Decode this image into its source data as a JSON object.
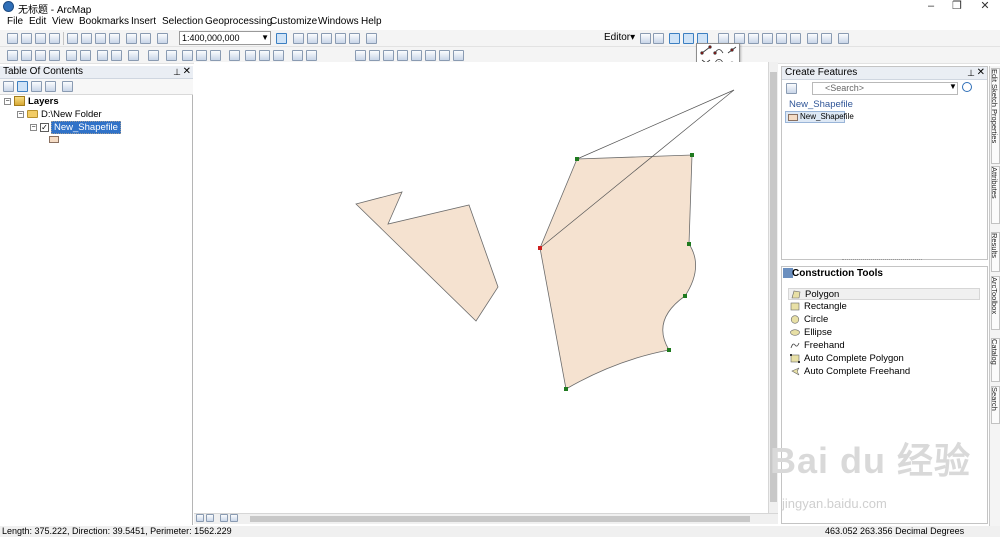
{
  "window": {
    "title": "无标题 - ArcMap",
    "buttons": [
      "–",
      "❐",
      "✕"
    ]
  },
  "menu": [
    "File",
    "Edit",
    "View",
    "Bookmarks",
    "Insert",
    "Selection",
    "Geoprocessing",
    "Customize",
    "Windows",
    "Help"
  ],
  "toolbar": {
    "scale": "1:400,000,000",
    "editor_label": "Editor▾"
  },
  "toc": {
    "title": "Table Of Contents",
    "root": "Layers",
    "folder": "D:\\New Folder",
    "layer": "New_Shapefile",
    "layer_checked": true
  },
  "create_features": {
    "title": "Create Features",
    "search_placeholder": "<Search>",
    "group_label": "New_Shapefile",
    "template_label": "New_Shapefile"
  },
  "construction_tools": {
    "title": "Construction Tools",
    "items": [
      {
        "label": "Polygon",
        "icon": "polygon-icon",
        "active": true
      },
      {
        "label": "Rectangle",
        "icon": "rectangle-icon",
        "active": false
      },
      {
        "label": "Circle",
        "icon": "circle-icon",
        "active": false
      },
      {
        "label": "Ellipse",
        "icon": "ellipse-icon",
        "active": false
      },
      {
        "label": "Freehand",
        "icon": "freehand-icon",
        "active": false
      },
      {
        "label": "Auto Complete Polygon",
        "icon": "auto-complete-polygon-icon",
        "active": false
      },
      {
        "label": "Auto Complete Freehand",
        "icon": "auto-complete-freehand-icon",
        "active": false
      }
    ]
  },
  "side_tabs": [
    "Edit Sketch Properties",
    "Attributes",
    "Results",
    "ArcToolbox",
    "Catalog",
    "Search"
  ],
  "status": {
    "left": "Length: 375.222, Direction: 39.5451, Perimeter: 1562.229",
    "right": "463.052  263.356 Decimal Degrees"
  },
  "watermark": {
    "brand": "Bai du 经验",
    "url": "jingyan.baidu.com"
  },
  "colors": {
    "polygon_fill": "#f5e2d0",
    "polygon_outline": "#6b6b6b",
    "vertex": "#1f7a1f",
    "active_vertex": "#cc1f1f",
    "selection": "#3072c8"
  }
}
